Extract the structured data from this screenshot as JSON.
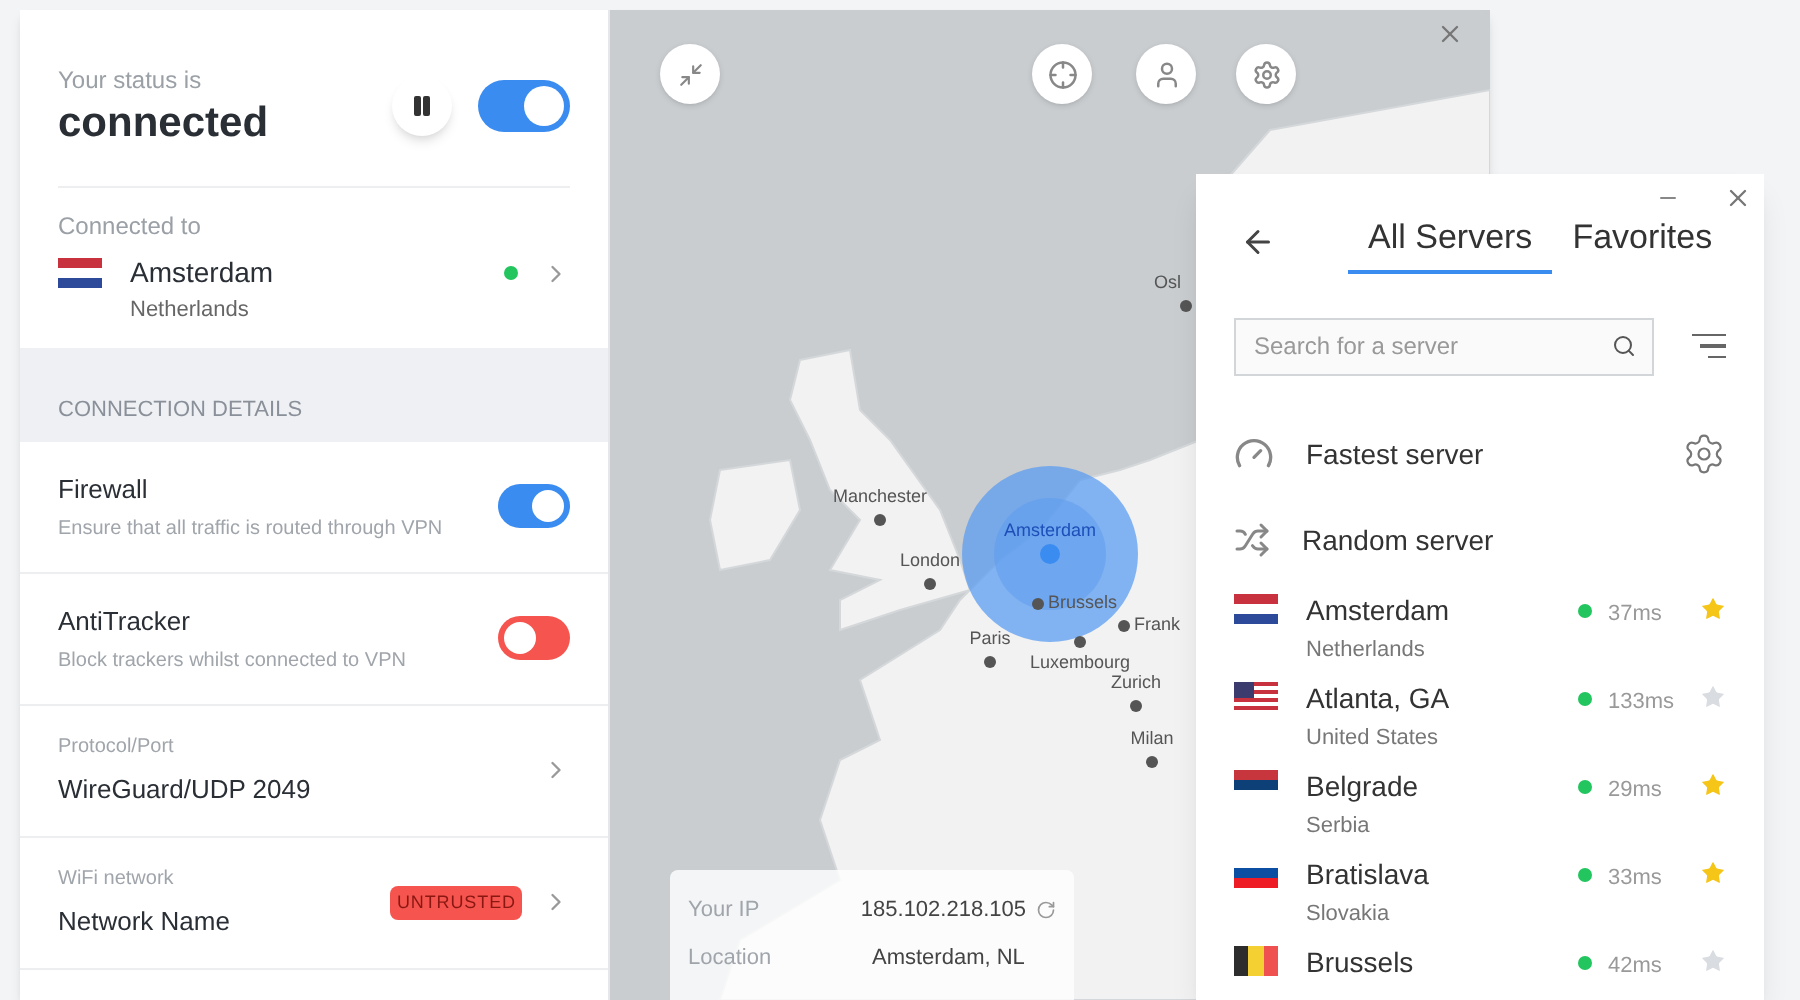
{
  "status": {
    "label": "Your status is",
    "value": "connected",
    "paused": false,
    "on": true
  },
  "connection": {
    "label": "Connected to",
    "city": "Amsterdam",
    "country": "Netherlands",
    "kind": "nl",
    "online": true
  },
  "section_header": "CONNECTION DETAILS",
  "settings": [
    {
      "kind": "toggle",
      "title": "Firewall",
      "description": "Ensure that all traffic is routed through VPN",
      "on": true
    },
    {
      "kind": "toggle",
      "title": "AntiTracker",
      "description": "Block trackers whilst connected to VPN",
      "on": false
    },
    {
      "kind": "select",
      "label": "Protocol/Port",
      "value": "WireGuard/UDP 2049"
    },
    {
      "kind": "select",
      "label": "WiFi network",
      "value": "Network Name",
      "badge": "UNTRUSTED"
    }
  ],
  "map": {
    "cities": [
      {
        "name": "Osl",
        "selected": false
      },
      {
        "name": "Manchester",
        "selected": false
      },
      {
        "name": "London",
        "selected": false
      },
      {
        "name": "Amsterdam",
        "selected": true
      },
      {
        "name": "Brussels",
        "selected": false
      },
      {
        "name": "Frank",
        "selected": false
      },
      {
        "name": "Paris",
        "selected": false
      },
      {
        "name": "Luxembourg",
        "selected": false
      },
      {
        "name": "Zurich",
        "selected": false
      },
      {
        "name": "Milan",
        "selected": false
      }
    ],
    "info": [
      {
        "label": "Your IP",
        "value": "185.102.218.105",
        "refresh": true
      },
      {
        "label": "Location",
        "value": "Amsterdam, NL",
        "refresh": false
      }
    ]
  },
  "servers_window": {
    "tabs": [
      {
        "label": "All Servers",
        "selected": true
      },
      {
        "label": "Favorites",
        "selected": false
      }
    ],
    "search": {
      "placeholder": "Search for a server"
    },
    "quick": [
      {
        "kind": "fastest",
        "label": "Fastest server"
      },
      {
        "kind": "random",
        "label": "Random server"
      }
    ],
    "servers": [
      {
        "city": "Amsterdam",
        "country": "Netherlands",
        "kind": "nl",
        "online": true,
        "ping": "37ms",
        "favorite": true
      },
      {
        "city": "Atlanta, GA",
        "country": "United States",
        "kind": "us",
        "online": true,
        "ping": "133ms",
        "favorite": false
      },
      {
        "city": "Belgrade",
        "country": "Serbia",
        "kind": "rs",
        "online": true,
        "ping": "29ms",
        "favorite": true
      },
      {
        "city": "Bratislava",
        "country": "Slovakia",
        "kind": "sk",
        "online": true,
        "ping": "33ms",
        "favorite": true
      },
      {
        "city": "Brussels",
        "kind": "be",
        "online": true,
        "ping": "42ms",
        "favorite": false
      }
    ]
  }
}
